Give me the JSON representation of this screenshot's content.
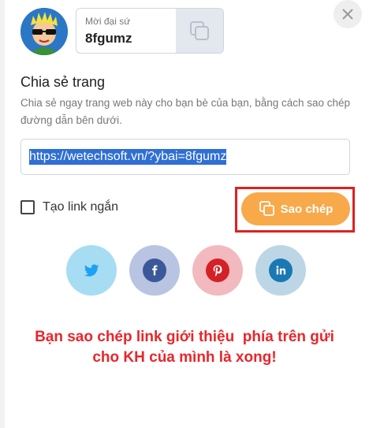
{
  "referral": {
    "label": "Mời đại sứ",
    "code": "8fgumz"
  },
  "share": {
    "title": "Chia sẻ trang",
    "description": "Chia sẻ ngay trang web này cho bạn bè của bạn, bằng cách sao chép đường dẫn bên dưới.",
    "url": "https://wetechsoft.vn/?ybai=8fgumz"
  },
  "options": {
    "short_link_label": "Tạo link ngắn",
    "short_link_checked": false
  },
  "copy_button": {
    "label": "Sao chép"
  },
  "social": [
    {
      "name": "twitter",
      "icon": "twitter-icon",
      "bg": "#a7ddf3",
      "fg": "#1da1f2"
    },
    {
      "name": "facebook",
      "icon": "facebook-icon",
      "bg": "#b9c3e2",
      "fg": "#3b5998"
    },
    {
      "name": "pinterest",
      "icon": "pinterest-icon",
      "bg": "#f2b9be",
      "fg": "#d42128"
    },
    {
      "name": "linkedin",
      "icon": "linkedin-icon",
      "bg": "#bcd6e6",
      "fg": "#1a78b3"
    }
  ],
  "annotation": {
    "line1": "Bạn sao chép link giới thiệu  phía trên gửi",
    "line2": "cho KH của mình là xong!"
  },
  "colors": {
    "accent": "#f8a94a",
    "highlight": "#e02020",
    "selection": "#2f6fd4"
  }
}
